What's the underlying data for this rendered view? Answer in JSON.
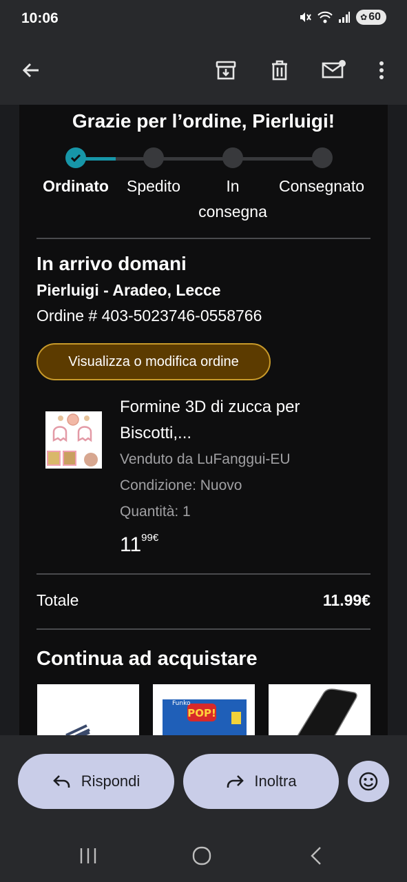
{
  "status": {
    "time": "10:06",
    "battery": "60"
  },
  "email": {
    "thanks": "Grazie per l’ordine, Pierluigi!",
    "steps": [
      "Ordinato",
      "Spedito",
      "In",
      "consegna",
      "Consegnato"
    ],
    "arrival_title": "In arrivo domani",
    "arrival_address": "Pierluigi - Aradeo, Lecce",
    "order_number": "Ordine # 403-5023746-0558766",
    "view_button": "Visualizza o modifica ordine",
    "product": {
      "name_line1": "Formine 3D di zucca per",
      "name_line2": "Biscotti,...",
      "seller": "Venduto da LuFanggui-EU",
      "condition": "Condizione: Nuovo",
      "quantity": "Quantità: 1",
      "price_whole": "11",
      "price_fraction": "99€"
    },
    "total_label": "Totale",
    "total_value": "11.99€",
    "continue_title": "Continua ad acquistare"
  },
  "actions": {
    "reply": "Rispondi",
    "forward": "Inoltra"
  },
  "colors": {
    "accent": "#1796a8",
    "button_fill": "#5c3b00",
    "button_border": "#c89a2a",
    "action_pill": "#c9cde8"
  }
}
